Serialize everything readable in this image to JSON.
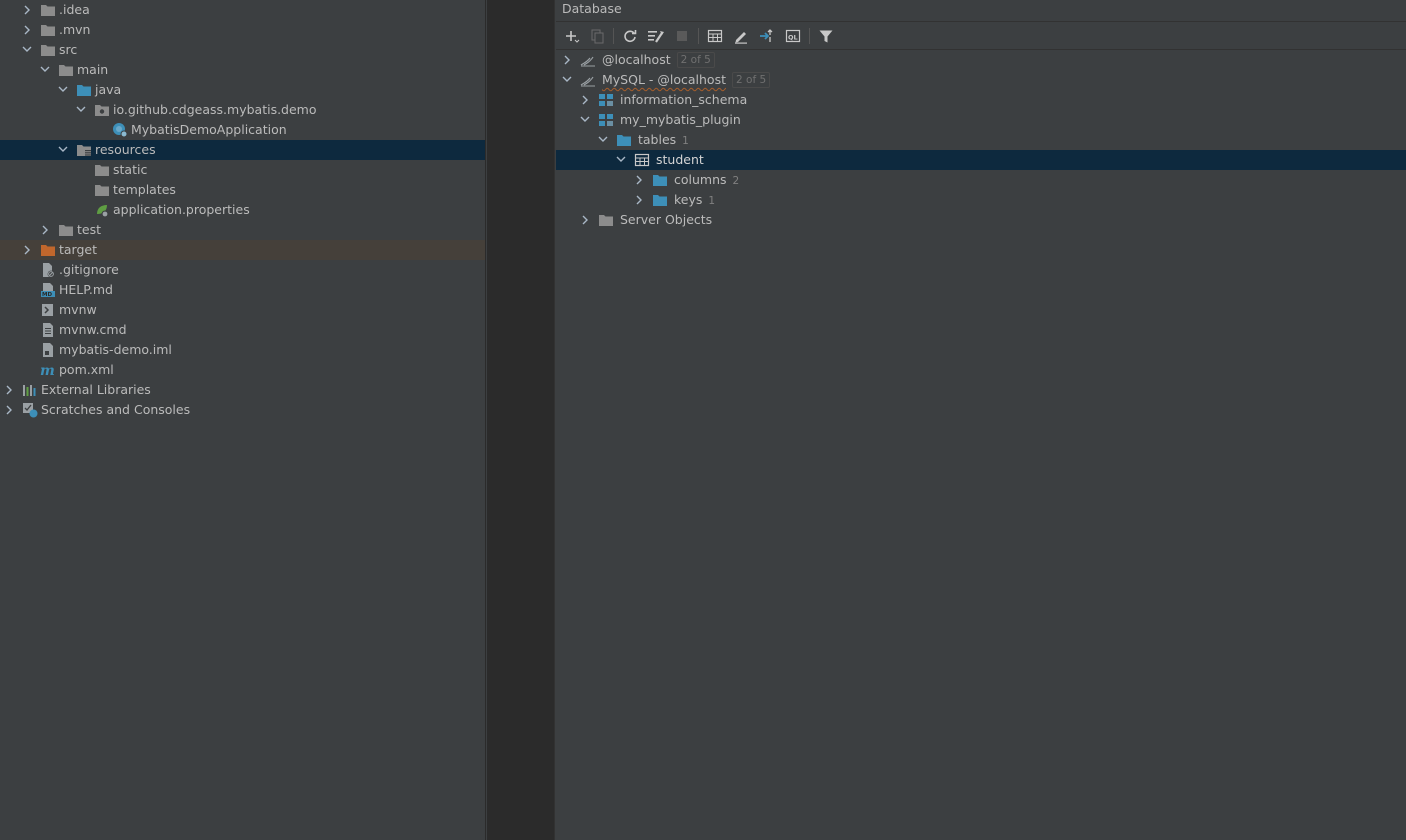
{
  "project_tree": {
    "items": [
      {
        "label": ".idea"
      },
      {
        "label": ".mvn"
      },
      {
        "label": "src"
      },
      {
        "label": "main"
      },
      {
        "label": "java"
      },
      {
        "label": "io.github.cdgeass.mybatis.demo"
      },
      {
        "label": "MybatisDemoApplication"
      },
      {
        "label": "resources"
      },
      {
        "label": "static"
      },
      {
        "label": "templates"
      },
      {
        "label": "application.properties"
      },
      {
        "label": "test"
      },
      {
        "label": "target"
      },
      {
        "label": ".gitignore"
      },
      {
        "label": "HELP.md"
      },
      {
        "label": "mvnw"
      },
      {
        "label": "mvnw.cmd"
      },
      {
        "label": "mybatis-demo.iml"
      },
      {
        "label": "pom.xml"
      },
      {
        "label": "External Libraries"
      },
      {
        "label": "Scratches and Consoles"
      }
    ]
  },
  "database": {
    "title": "Database",
    "toolbar_icons": [
      "add-icon",
      "duplicate-icon",
      "refresh-icon",
      "schema-settings-icon",
      "stop-icon",
      "table-icon",
      "edit-icon",
      "jump-to-icon",
      "console-icon",
      "filter-icon"
    ],
    "tree": [
      {
        "label": "@localhost",
        "badge": "2 of 5"
      },
      {
        "label": "MySQL - @localhost",
        "badge": "2 of 5"
      },
      {
        "label": "information_schema"
      },
      {
        "label": "my_mybatis_plugin"
      },
      {
        "label": "tables",
        "count": "1"
      },
      {
        "label": "student"
      },
      {
        "label": "columns",
        "count": "2"
      },
      {
        "label": "keys",
        "count": "1"
      },
      {
        "label": "Server Objects"
      }
    ]
  },
  "colors": {
    "panel_bg": "#3c3f41",
    "selection": "#0d293e",
    "excluded_row": "#45403a",
    "folder_grey": "#8c8c8c",
    "folder_blue": "#3d8fb8",
    "folder_orange": "#c2672c"
  }
}
